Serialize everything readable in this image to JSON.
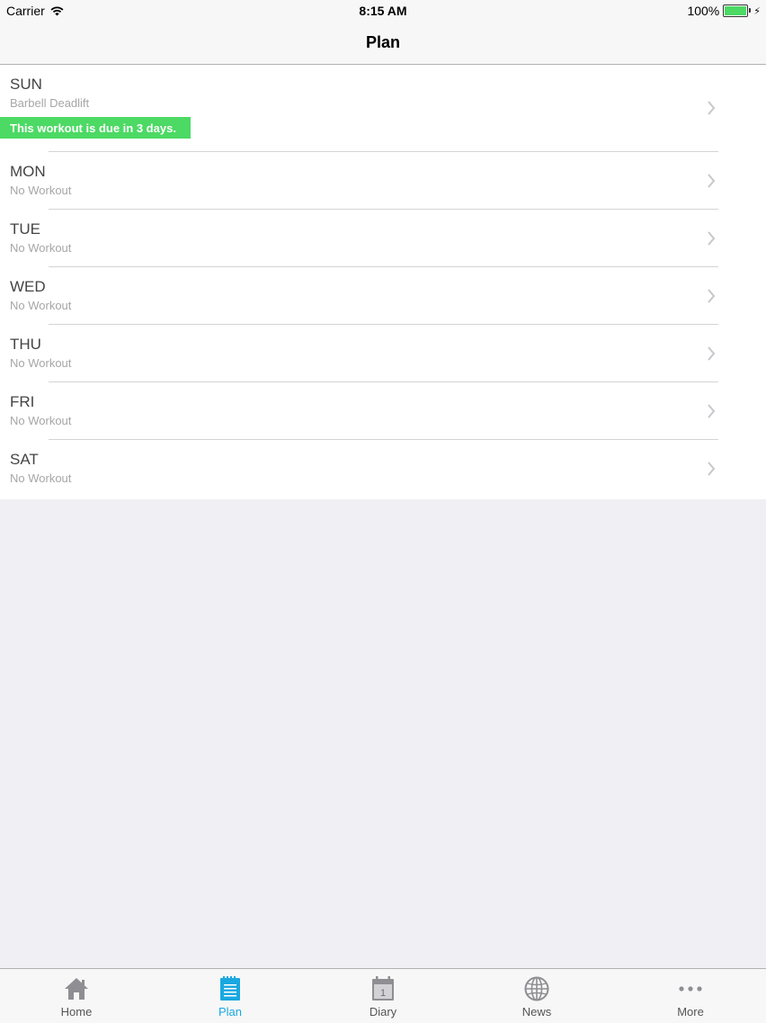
{
  "status_bar": {
    "carrier": "Carrier",
    "time": "8:15 AM",
    "battery": "100%"
  },
  "nav": {
    "title": "Plan"
  },
  "plan": {
    "rows": [
      {
        "day": "SUN",
        "workout": "Barbell Deadlift",
        "badge": "This workout is due in 3 days."
      },
      {
        "day": "MON",
        "workout": "No Workout"
      },
      {
        "day": "TUE",
        "workout": "No Workout"
      },
      {
        "day": "WED",
        "workout": "No Workout"
      },
      {
        "day": "THU",
        "workout": "No Workout"
      },
      {
        "day": "FRI",
        "workout": "No Workout"
      },
      {
        "day": "SAT",
        "workout": "No Workout"
      }
    ],
    "badge_color": "#4cd964"
  },
  "tabs": [
    {
      "label": "Home",
      "icon": "home-icon"
    },
    {
      "label": "Plan",
      "icon": "plan-icon",
      "active": true
    },
    {
      "label": "Diary",
      "icon": "calendar-icon",
      "calendar_day": "1"
    },
    {
      "label": "News",
      "icon": "globe-icon"
    },
    {
      "label": "More",
      "icon": "more-icon"
    }
  ],
  "colors": {
    "accent": "#1aa8e0",
    "background": "#efeff4"
  }
}
